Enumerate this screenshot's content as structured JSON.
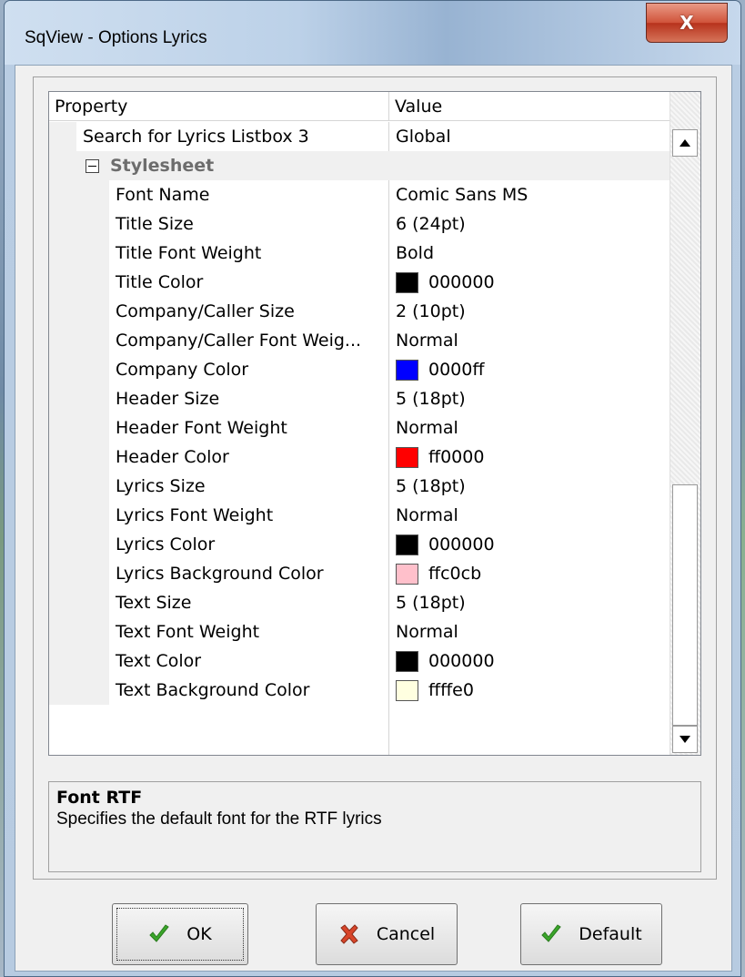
{
  "window": {
    "title": "SqView - Options Lyrics",
    "close_label": "X"
  },
  "grid": {
    "header": {
      "property": "Property",
      "value": "Value"
    },
    "top_row": {
      "name": "Search for Lyrics Listbox 3",
      "value": "Global"
    },
    "category": {
      "label": "Stylesheet",
      "expanded": true
    },
    "rows": [
      {
        "name": "Font Name",
        "value": "Comic Sans MS"
      },
      {
        "name": "Title Size",
        "value": "6 (24pt)"
      },
      {
        "name": "Title Font Weight",
        "value": "Bold"
      },
      {
        "name": "Title Color",
        "value": "000000",
        "swatch": "#000000"
      },
      {
        "name": "Company/Caller Size",
        "value": "2 (10pt)"
      },
      {
        "name": "Company/Caller Font Weig...",
        "value": "Normal"
      },
      {
        "name": "Company Color",
        "value": "0000ff",
        "swatch": "#0000ff"
      },
      {
        "name": "Header Size",
        "value": "5 (18pt)"
      },
      {
        "name": "Header Font Weight",
        "value": "Normal"
      },
      {
        "name": "Header Color",
        "value": "ff0000",
        "swatch": "#ff0000"
      },
      {
        "name": "Lyrics Size",
        "value": "5 (18pt)"
      },
      {
        "name": "Lyrics Font Weight",
        "value": "Normal"
      },
      {
        "name": "Lyrics Color",
        "value": "000000",
        "swatch": "#000000"
      },
      {
        "name": "Lyrics Background Color",
        "value": "ffc0cb",
        "swatch": "#ffc0cb"
      },
      {
        "name": "Text Size",
        "value": "5 (18pt)"
      },
      {
        "name": "Text Font Weight",
        "value": "Normal"
      },
      {
        "name": "Text Color",
        "value": "000000",
        "swatch": "#000000"
      },
      {
        "name": "Text Background Color",
        "value": "ffffe0",
        "swatch": "#ffffe0"
      }
    ]
  },
  "description": {
    "title": "Font RTF",
    "text": "Specifies the default font for the RTF lyrics"
  },
  "buttons": {
    "ok": {
      "label": "OK",
      "icon": "check-icon"
    },
    "cancel": {
      "label": "Cancel",
      "icon": "cross-icon"
    },
    "default": {
      "label": "Default",
      "icon": "check-icon"
    }
  },
  "colors": {
    "check": "#3aa62a",
    "cross": "#d8452a",
    "close_button": "#c9452c"
  }
}
